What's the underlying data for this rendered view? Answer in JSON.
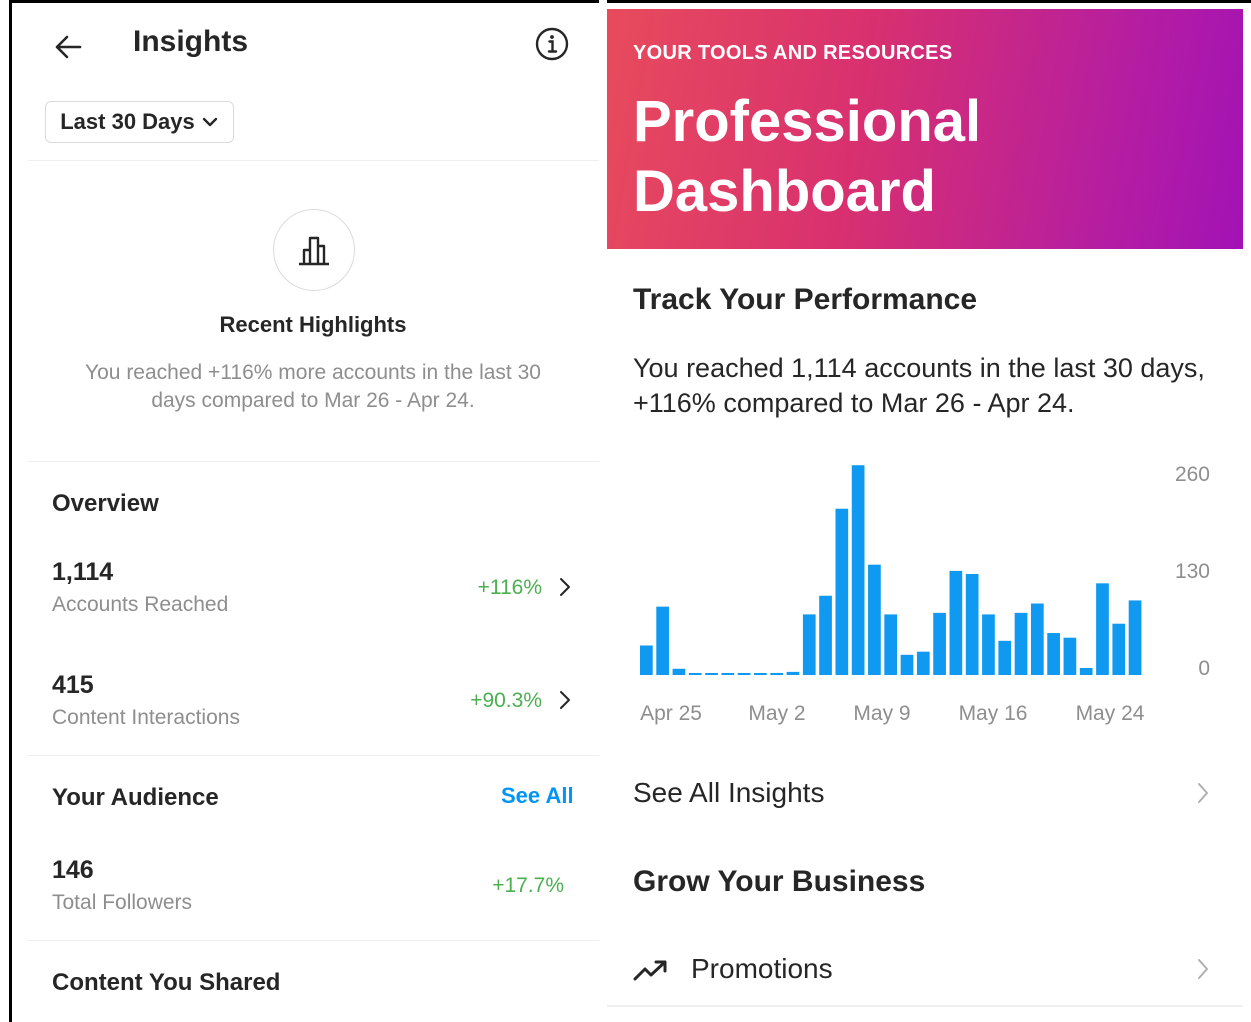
{
  "insights": {
    "title": "Insights",
    "range_label": "Last 30 Days",
    "highlights": {
      "title": "Recent Highlights",
      "description": "You reached +116% more accounts in the last 30 days compared to Mar 26 - Apr 24."
    },
    "overview": {
      "title": "Overview",
      "metrics": [
        {
          "value": "1,114",
          "label": "Accounts Reached",
          "change": "+116%"
        },
        {
          "value": "415",
          "label": "Content Interactions",
          "change": "+90.3%"
        }
      ]
    },
    "audience": {
      "title": "Your Audience",
      "see_all": "See All",
      "metrics": [
        {
          "value": "146",
          "label": "Total Followers",
          "change": "+17.7%"
        }
      ]
    },
    "content_shared": {
      "title": "Content You Shared"
    }
  },
  "dashboard": {
    "banner_subtitle": "YOUR TOOLS AND RESOURCES",
    "banner_title": "Professional Dashboard",
    "track_title": "Track Your Performance",
    "track_description": "You reached 1,114 accounts in the last 30 days, +116% compared to Mar 26 - Apr 24.",
    "see_all_insights": "See All Insights",
    "grow_title": "Grow Your Business",
    "promotions": "Promotions"
  },
  "chart_data": {
    "type": "bar",
    "x_tick_labels": [
      "Apr 25",
      "May 2",
      "May 9",
      "May 16",
      "May 24"
    ],
    "y_tick_labels": [
      "260",
      "130",
      "0"
    ],
    "ylim": [
      0,
      260
    ],
    "values": [
      38,
      88,
      8,
      2,
      2,
      2,
      2,
      2,
      2,
      4,
      78,
      102,
      214,
      270,
      142,
      78,
      26,
      30,
      80,
      134,
      130,
      78,
      44,
      80,
      92,
      54,
      48,
      9,
      118,
      66,
      96
    ],
    "bar_color": "#0f99f0"
  },
  "colors": {
    "accent_blue": "#0095f6",
    "positive_green": "#4caf50",
    "muted_text": "#8e8e8e"
  }
}
